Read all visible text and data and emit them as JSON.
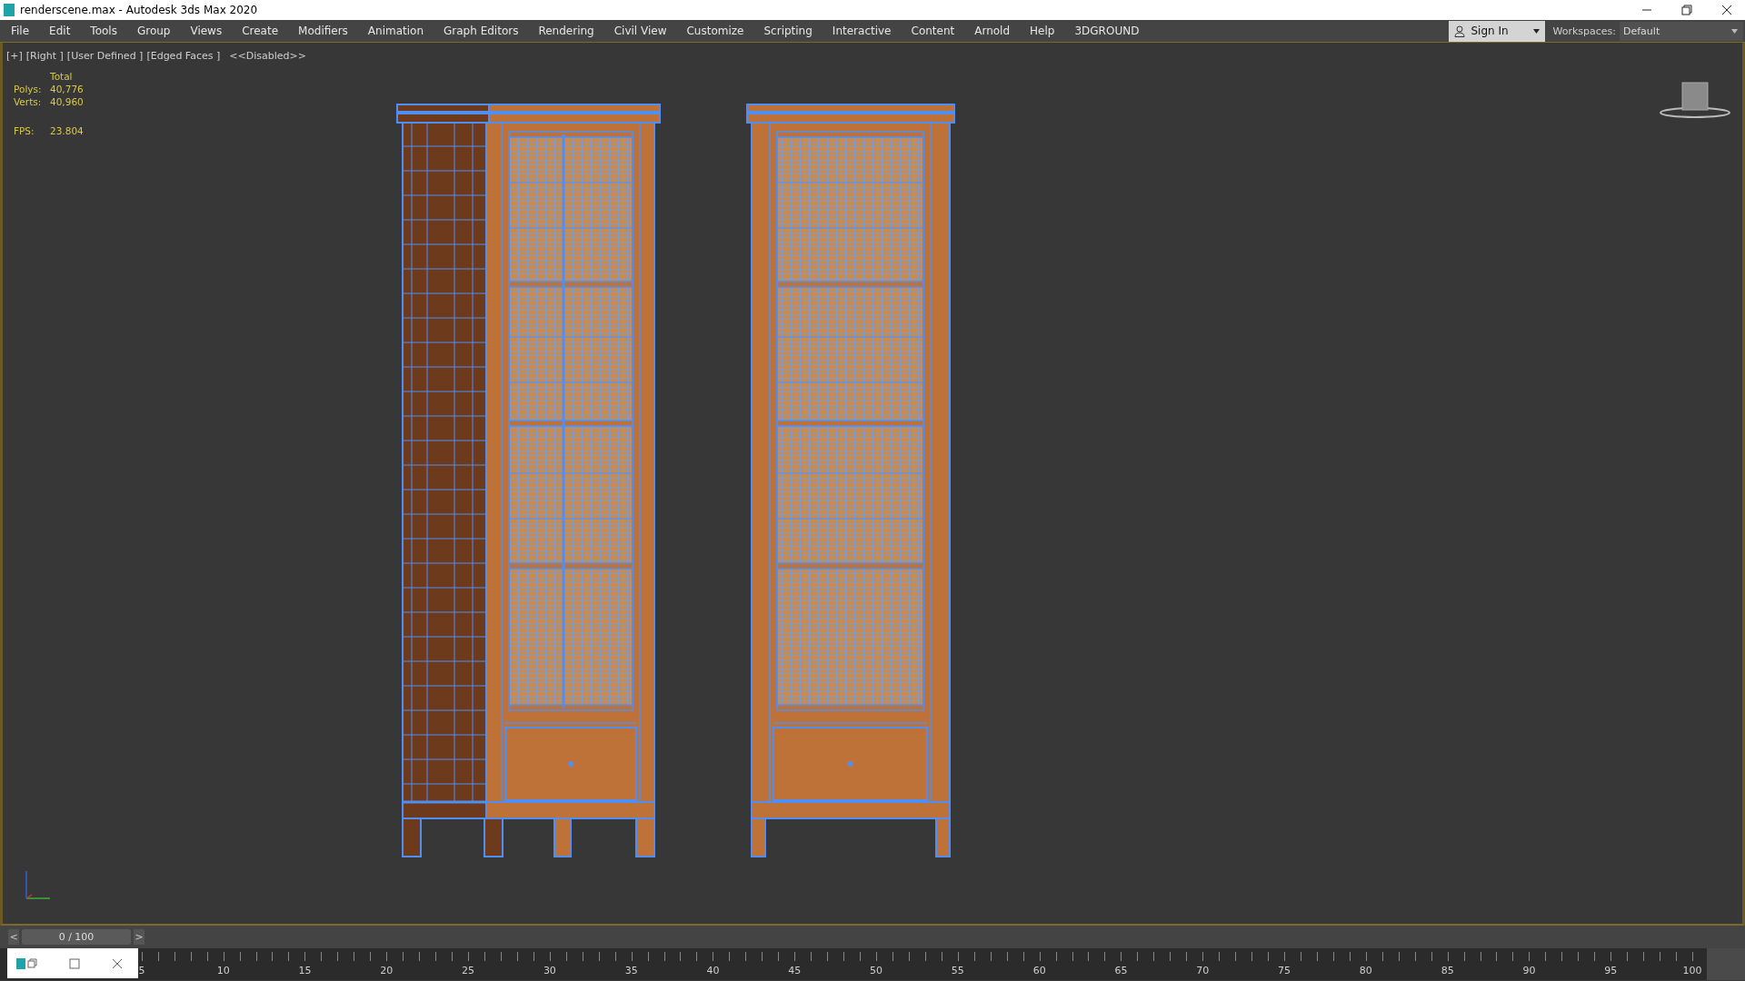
{
  "window": {
    "title": "renderscene.max - Autodesk 3ds Max 2020"
  },
  "menu": [
    "File",
    "Edit",
    "Tools",
    "Group",
    "Views",
    "Create",
    "Modifiers",
    "Animation",
    "Graph Editors",
    "Rendering",
    "Civil View",
    "Customize",
    "Scripting",
    "Interactive",
    "Content",
    "Arnold",
    "Help",
    "3DGROUND"
  ],
  "sign_in": {
    "label": "Sign In"
  },
  "workspaces": {
    "label": "Workspaces:",
    "value": "Default"
  },
  "viewport": {
    "labels": [
      "[+]",
      "[Right ]",
      "[User Defined ]",
      "[Edged Faces ]",
      "<<Disabled>>"
    ],
    "stats": {
      "header": "Total",
      "rows": [
        {
          "label": "Polys:",
          "value": "40,776"
        },
        {
          "label": "Verts:",
          "value": "40,960"
        },
        {
          "label": "FPS:",
          "value": "23.804"
        }
      ]
    }
  },
  "time_slider": {
    "prev": "<",
    "frame": "0 / 100",
    "next": ">",
    "level": 0
  },
  "timeline": {
    "ticks": [
      "5",
      "10",
      "15",
      "20",
      "25",
      "30",
      "35",
      "40",
      "45",
      "50",
      "55",
      "60",
      "65",
      "70",
      "75",
      "80",
      "85",
      "90",
      "95",
      "100"
    ]
  }
}
